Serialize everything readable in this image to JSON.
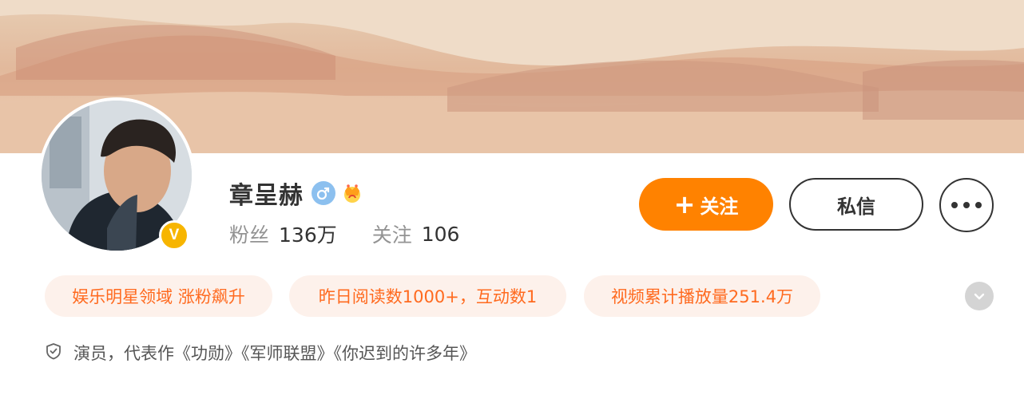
{
  "profile": {
    "name": "章呈赫",
    "verified_badge": "V",
    "gender_icon": "male-icon",
    "level_icon": "crown-icon",
    "colors": {
      "accent": "#ff8200",
      "tag_text": "#ff6a1f",
      "tag_bg": "#fdf1eb",
      "verified": "#f7b500",
      "gender": "#8cc0ef"
    }
  },
  "stats": {
    "fans_label": "粉丝",
    "fans_value": "136万",
    "following_label": "关注",
    "following_value": "106"
  },
  "actions": {
    "follow_icon": "+",
    "follow_label": "关注",
    "message_label": "私信",
    "more_icon": "more-icon"
  },
  "tags": [
    "娱乐明星领域 涨粉飙升",
    "昨日阅读数1000+，互动数1",
    "视频累计播放量251.4万"
  ],
  "bio": {
    "icon": "shield-icon",
    "text": "演员，代表作《功勋》《军师联盟》《你迟到的许多年》"
  }
}
